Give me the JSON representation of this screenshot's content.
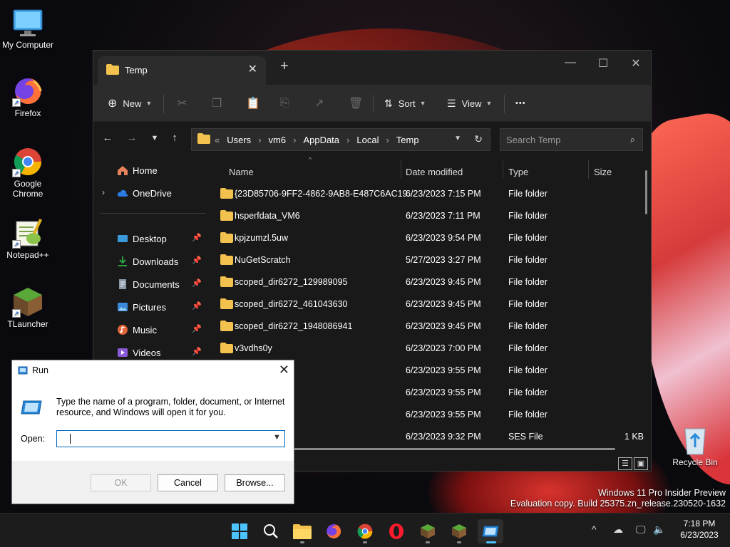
{
  "desktop": {
    "icons": [
      {
        "label": "My Computer",
        "icon": "monitor-icon"
      },
      {
        "label": "Firefox",
        "icon": "firefox-icon"
      },
      {
        "label": "Google Chrome",
        "icon": "chrome-icon"
      },
      {
        "label": "Notepad++",
        "icon": "notepadpp-icon"
      },
      {
        "label": "TLauncher",
        "icon": "tlauncher-icon"
      }
    ],
    "recycle_bin": "Recycle Bin",
    "watermark": {
      "line1": "Windows 11 Pro Insider Preview",
      "line2": "Evaluation copy. Build 25375.zn_release.230520-1632"
    }
  },
  "explorer": {
    "tab_title": "Temp",
    "tab_close": "✕",
    "tab_add": "+",
    "window_controls": {
      "minimize": "—",
      "maximize": "☐",
      "close": "✕"
    },
    "toolbar": {
      "new_label": "New",
      "sort_label": "Sort",
      "view_label": "View",
      "more_label": "•••"
    },
    "breadcrumb": [
      "Users",
      "vm6",
      "AppData",
      "Local",
      "Temp"
    ],
    "search_placeholder": "Search Temp",
    "nav": {
      "home": "Home",
      "onedrive": "OneDrive",
      "quick": [
        {
          "label": "Desktop",
          "icon": "desktop-icon",
          "color": "#3a9ad9"
        },
        {
          "label": "Downloads",
          "icon": "downloads-icon",
          "color": "#2ea043"
        },
        {
          "label": "Documents",
          "icon": "documents-icon",
          "color": "#8a9aa8"
        },
        {
          "label": "Pictures",
          "icon": "pictures-icon",
          "color": "#3a8ad9"
        },
        {
          "label": "Music",
          "icon": "music-icon",
          "color": "#e0643a"
        },
        {
          "label": "Videos",
          "icon": "videos-icon",
          "color": "#8a5ad9"
        }
      ]
    },
    "columns": {
      "name": "Name",
      "date": "Date modified",
      "type": "Type",
      "size": "Size"
    },
    "files": [
      {
        "name": "{23D85706-9FF2-4862-9AB8-E487C6AC19...",
        "date": "6/23/2023 7:15 PM",
        "type": "File folder",
        "size": ""
      },
      {
        "name": "hsperfdata_VM6",
        "date": "6/23/2023 7:11 PM",
        "type": "File folder",
        "size": ""
      },
      {
        "name": "kpjzumzl.5uw",
        "date": "6/23/2023 9:54 PM",
        "type": "File folder",
        "size": ""
      },
      {
        "name": "NuGetScratch",
        "date": "5/27/2023 3:27 PM",
        "type": "File folder",
        "size": ""
      },
      {
        "name": "scoped_dir6272_129989095",
        "date": "6/23/2023 9:45 PM",
        "type": "File folder",
        "size": ""
      },
      {
        "name": "scoped_dir6272_461043630",
        "date": "6/23/2023 9:45 PM",
        "type": "File folder",
        "size": ""
      },
      {
        "name": "scoped_dir6272_1948086941",
        "date": "6/23/2023 9:45 PM",
        "type": "File folder",
        "size": ""
      },
      {
        "name": "v3vdhs0y",
        "date": "6/23/2023 7:00 PM",
        "type": "File folder",
        "size": ""
      },
      {
        "name": "",
        "date": "6/23/2023 9:55 PM",
        "type": "File folder",
        "size": ""
      },
      {
        "name": "",
        "date": "6/23/2023 9:55 PM",
        "type": "File folder",
        "size": ""
      },
      {
        "name": "",
        "date": "6/23/2023 9:55 PM",
        "type": "File folder",
        "size": ""
      },
      {
        "name": "",
        "date": "6/23/2023 9:32 PM",
        "type": "SES File",
        "size": "1 KB"
      }
    ]
  },
  "run_dialog": {
    "title": "Run",
    "close": "✕",
    "description": "Type the name of a program, folder, document, or Internet resource, and Windows will open it for you.",
    "open_label": "Open:",
    "open_value": "",
    "ok_label": "OK",
    "cancel_label": "Cancel",
    "browse_label": "Browse..."
  },
  "taskbar": {
    "apps": [
      "start-icon",
      "search-icon",
      "file-explorer-icon",
      "firefox-icon",
      "chrome-icon",
      "opera-icon",
      "minecraft-icon",
      "minecraft-icon",
      "run-icon"
    ],
    "clock_time": "7:18 PM",
    "clock_date": "6/23/2023"
  },
  "colors": {
    "accent": "#4cc2ff",
    "folder": "#f2c14e",
    "taskbar": "#1c1c1c"
  }
}
